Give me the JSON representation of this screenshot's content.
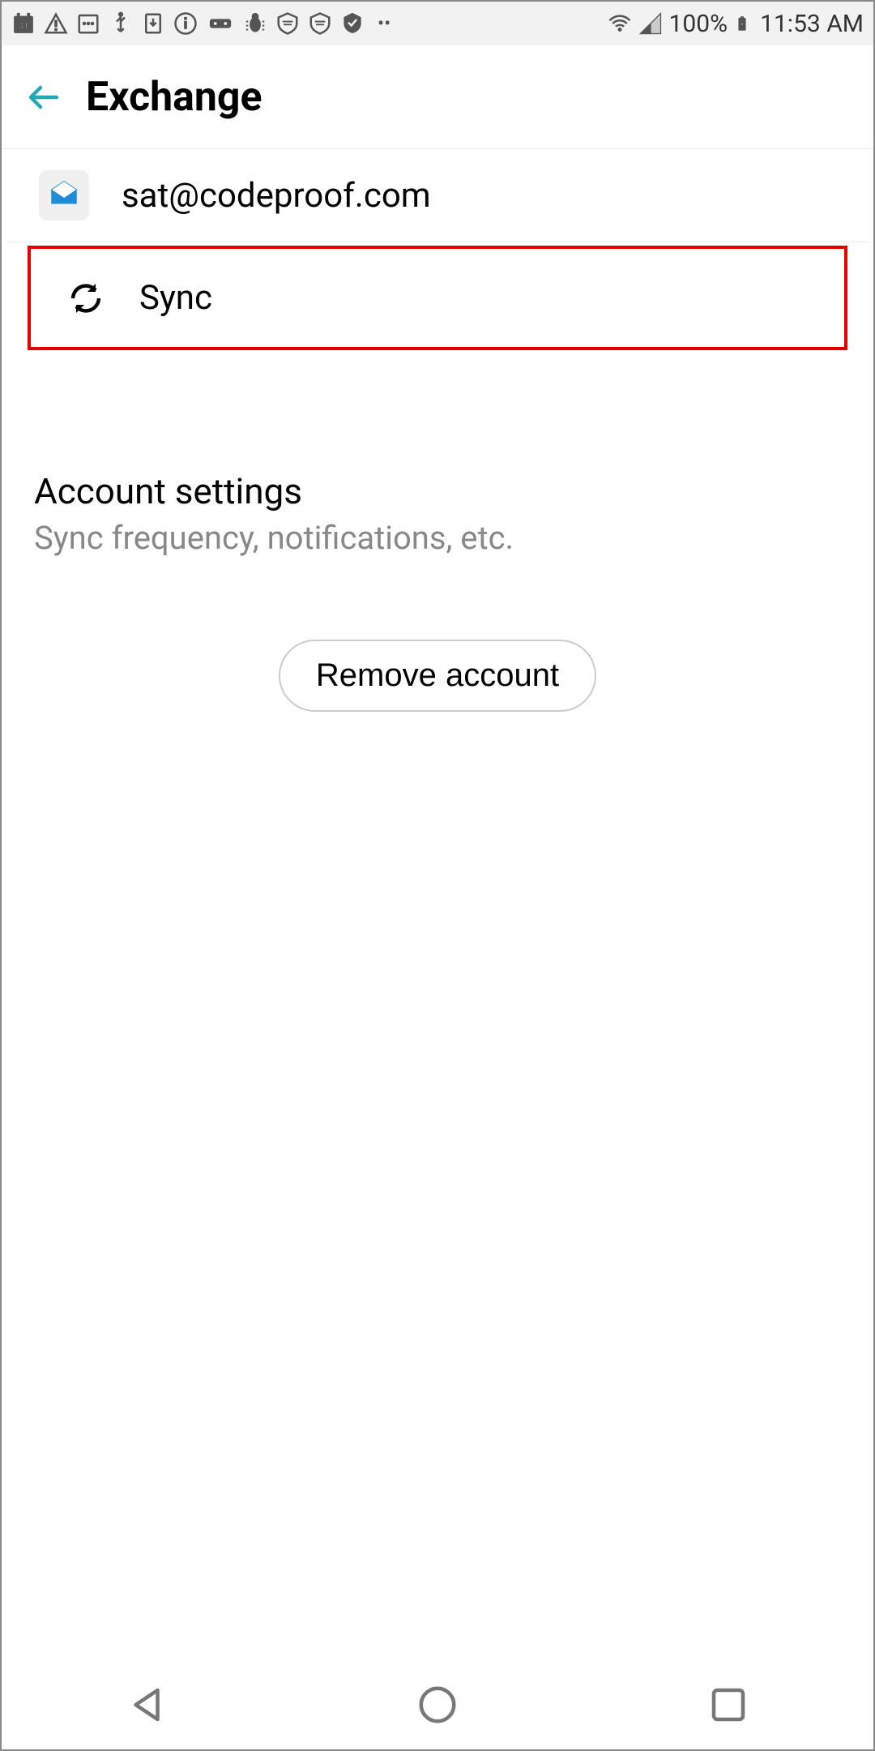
{
  "statusbar": {
    "battery_text": "100%",
    "time": "11:53 AM"
  },
  "header": {
    "title": "Exchange"
  },
  "account": {
    "email": "sat@codeproof.com"
  },
  "sync": {
    "label": "Sync"
  },
  "settings": {
    "title": "Account settings",
    "subtitle": "Sync frequency, notifications, etc."
  },
  "remove": {
    "label": "Remove account"
  }
}
